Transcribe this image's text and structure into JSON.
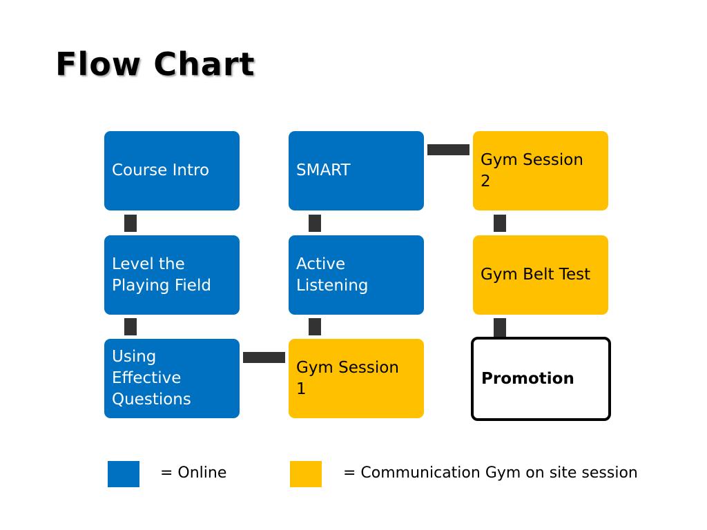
{
  "title": "Flow Chart",
  "colors": {
    "online": "#0070c0",
    "gym": "#ffc000",
    "connector": "#333333"
  },
  "nodes": [
    {
      "label": "Course Intro",
      "type": "online"
    },
    {
      "label": "Level the Playing Field",
      "type": "online"
    },
    {
      "label": "Using Effective Questions",
      "type": "online"
    },
    {
      "label": "SMART",
      "type": "online"
    },
    {
      "label": "Active Listening",
      "type": "online"
    },
    {
      "label": "Gym Session 1",
      "type": "gym"
    },
    {
      "label": "Gym Session 2",
      "type": "gym"
    },
    {
      "label": "Gym Belt Test",
      "type": "gym"
    },
    {
      "label": "Promotion",
      "type": "final"
    }
  ],
  "edges": [
    [
      "Course Intro",
      "Level the Playing Field"
    ],
    [
      "Level the Playing Field",
      "Using Effective Questions"
    ],
    [
      "Using Effective Questions",
      "Gym Session 1"
    ],
    [
      "Gym Session 1",
      "Active Listening"
    ],
    [
      "Active Listening",
      "SMART"
    ],
    [
      "SMART",
      "Gym Session 2"
    ],
    [
      "Gym Session 2",
      "Gym Belt Test"
    ],
    [
      "Gym Belt Test",
      "Promotion"
    ]
  ],
  "legend": [
    {
      "label": "= Online",
      "type": "online"
    },
    {
      "label": "= Communication Gym on site session",
      "type": "gym"
    }
  ]
}
